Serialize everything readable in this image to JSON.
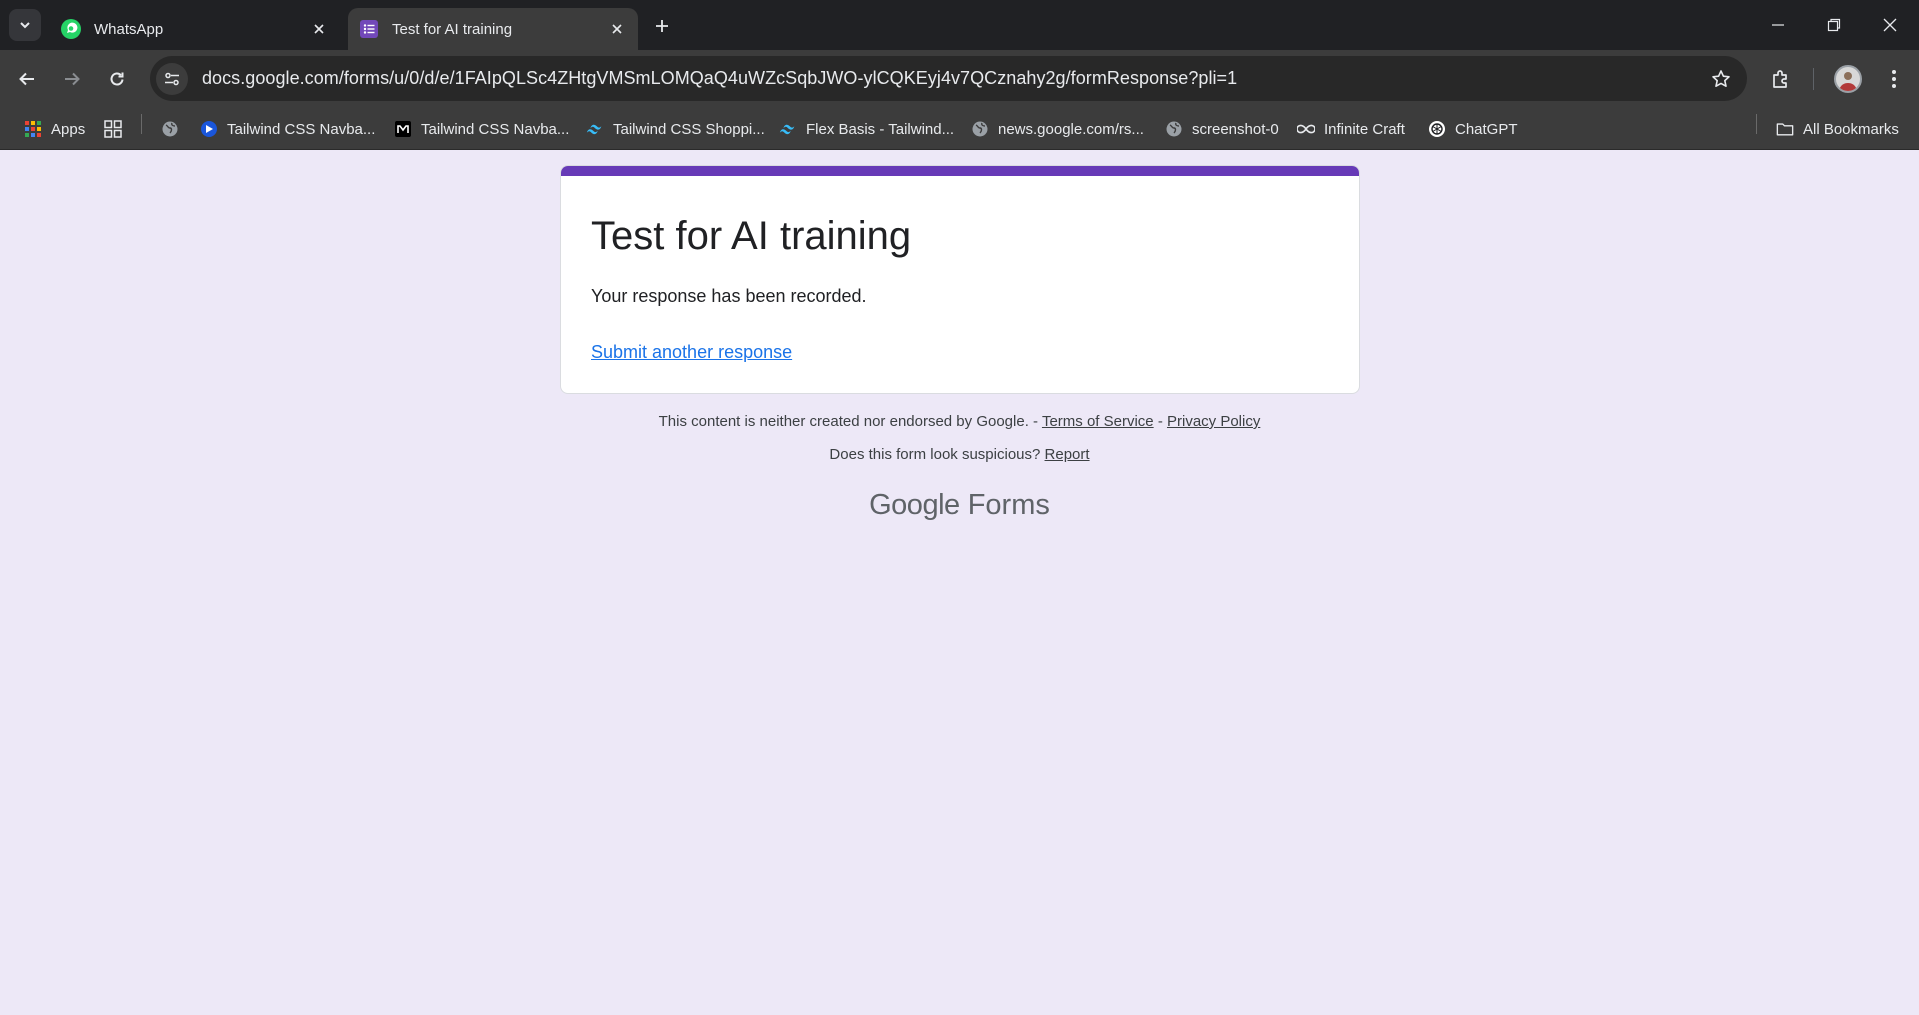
{
  "browser": {
    "tabs": [
      {
        "title": "WhatsApp",
        "icon": "whatsapp-icon",
        "active": false
      },
      {
        "title": "Test for AI training",
        "icon": "google-forms-icon",
        "active": true
      }
    ],
    "url": "docs.google.com/forms/u/0/d/e/1FAIpQLSc4ZHtgVMSmLOMQaQ4uWZcSqbJWO-ylCQKEyj4v7QCznahy2g/formResponse?pli=1",
    "bookmarks": {
      "apps_label": "Apps",
      "items": [
        {
          "label": "Tailwind CSS Navba...",
          "icon": "blue-circle-icon"
        },
        {
          "label": "Tailwind CSS Navba...",
          "icon": "m-logo-icon"
        },
        {
          "label": "Tailwind CSS Shoppi...",
          "icon": "tailwind-icon"
        },
        {
          "label": "Flex Basis - Tailwind...",
          "icon": "tailwind-icon"
        },
        {
          "label": "news.google.com/rs...",
          "icon": "globe-icon"
        },
        {
          "label": "screenshot-0",
          "icon": "globe-icon"
        },
        {
          "label": "Infinite Craft",
          "icon": "infinity-icon"
        },
        {
          "label": "ChatGPT",
          "icon": "chatgpt-icon"
        }
      ],
      "all_bookmarks_label": "All Bookmarks"
    }
  },
  "form": {
    "accent_color": "#673ab7",
    "title": "Test for AI training",
    "confirmation": "Your response has been recorded.",
    "another_link": "Submit another response"
  },
  "footer": {
    "disclaimer": "This content is neither created nor endorsed by Google. -",
    "terms": "Terms of Service",
    "dash": "-",
    "privacy": "Privacy Policy",
    "suspicious": "Does this form look suspicious?",
    "report": "Report",
    "brand_google": "Google",
    "brand_forms": "Forms"
  }
}
